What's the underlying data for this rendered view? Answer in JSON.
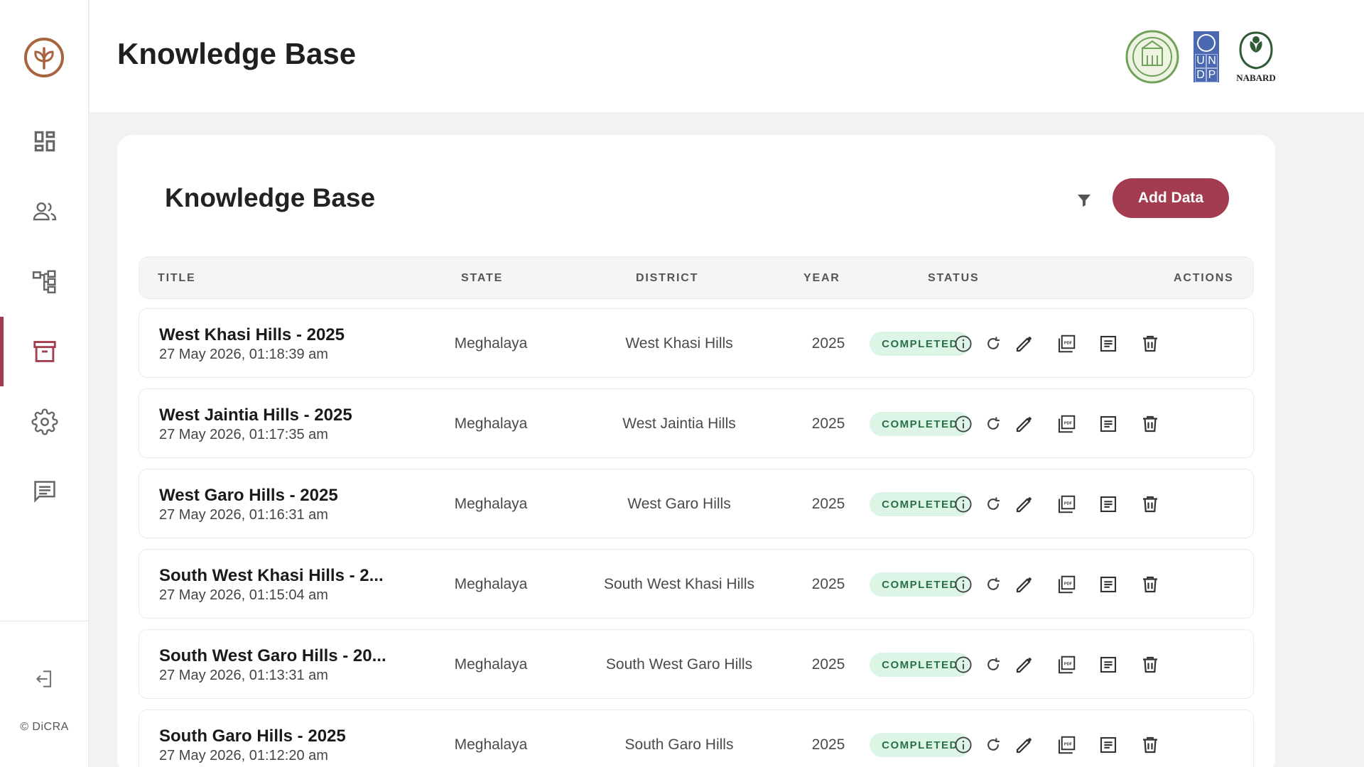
{
  "app": {
    "copyright": "© DiCRA",
    "accent_color": "#a23c4e"
  },
  "sidebar": {
    "items": [
      {
        "name": "dashboard",
        "icon": "dashboard-icon"
      },
      {
        "name": "users",
        "icon": "users-icon"
      },
      {
        "name": "hierarchy",
        "icon": "hierarchy-icon"
      },
      {
        "name": "knowledge-base",
        "icon": "archive-icon",
        "active": true
      },
      {
        "name": "settings",
        "icon": "gear-icon"
      },
      {
        "name": "feedback",
        "icon": "chat-icon"
      }
    ],
    "logout_icon": "logout-icon"
  },
  "header": {
    "title": "Knowledge Base",
    "partners": {
      "seal": "government-seal-logo",
      "undp_letters": [
        "U",
        "N",
        "D",
        "P"
      ],
      "nabard_label": "NABARD"
    }
  },
  "card": {
    "title": "Knowledge Base",
    "filter_icon": "filter-icon",
    "add_button": "Add Data"
  },
  "table": {
    "columns": {
      "title": "TITLE",
      "state": "STATE",
      "district": "DISTRICT",
      "year": "YEAR",
      "status": "STATUS",
      "actions": "ACTIONS"
    },
    "rows": [
      {
        "title": "West Khasi Hills - 2025",
        "date": "27 May 2026, 01:18:39 am",
        "state": "Meghalaya",
        "district": "West Khasi Hills",
        "year": "2025",
        "status": "COMPLETED"
      },
      {
        "title": "West Jaintia Hills - 2025",
        "date": "27 May 2026, 01:17:35 am",
        "state": "Meghalaya",
        "district": "West Jaintia Hills",
        "year": "2025",
        "status": "COMPLETED"
      },
      {
        "title": "West Garo Hills - 2025",
        "date": "27 May 2026, 01:16:31 am",
        "state": "Meghalaya",
        "district": "West Garo Hills",
        "year": "2025",
        "status": "COMPLETED"
      },
      {
        "title": "South West Khasi Hills - 2...",
        "date": "27 May 2026, 01:15:04 am",
        "state": "Meghalaya",
        "district": "South West Khasi Hills",
        "year": "2025",
        "status": "COMPLETED"
      },
      {
        "title": "South West Garo Hills - 20...",
        "date": "27 May 2026, 01:13:31 am",
        "state": "Meghalaya",
        "district": "South West Garo Hills",
        "year": "2025",
        "status": "COMPLETED"
      },
      {
        "title": "South Garo Hills - 2025",
        "date": "27 May 2026, 01:12:20 am",
        "state": "Meghalaya",
        "district": "South Garo Hills",
        "year": "2025",
        "status": "COMPLETED"
      }
    ],
    "row_actions": [
      "info-icon",
      "refresh-icon",
      "edit-icon",
      "pdf-icon",
      "document-icon",
      "delete-icon"
    ]
  }
}
